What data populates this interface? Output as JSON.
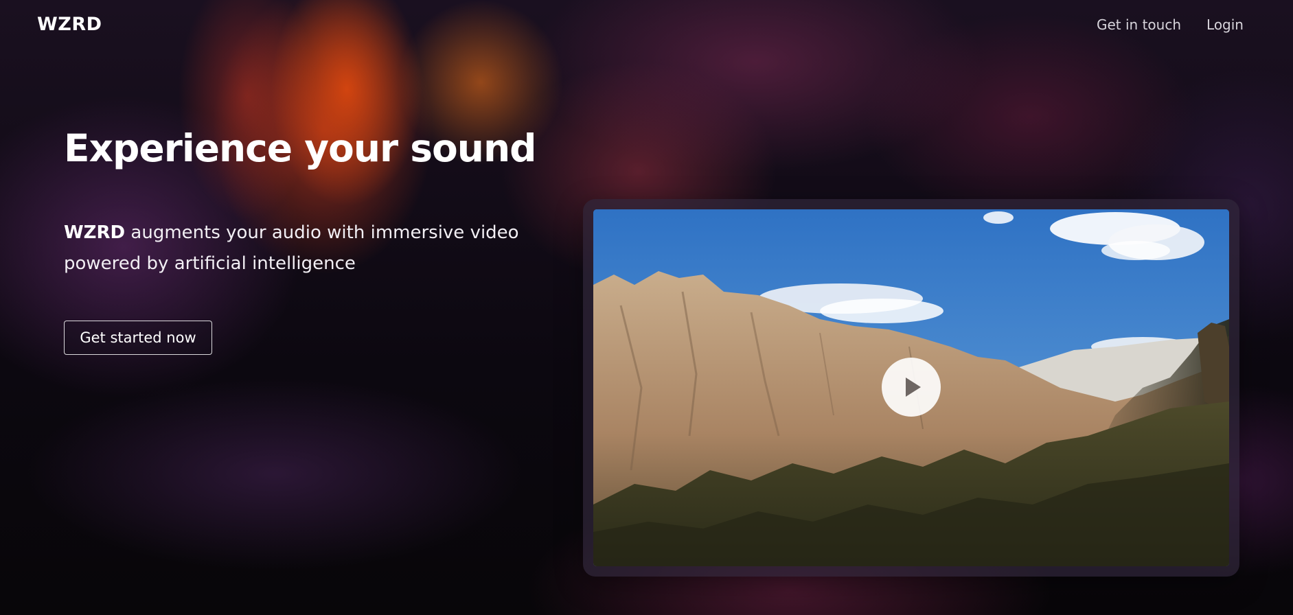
{
  "header": {
    "logo": "WZRD",
    "links": [
      {
        "label": "Get in touch"
      },
      {
        "label": "Login"
      }
    ]
  },
  "hero": {
    "title": "Experience your sound",
    "subtitle_brand": "WZRD",
    "subtitle_text": " augments your audio with immersive video powered by artificial intelligence",
    "cta_label": "Get started now"
  },
  "video": {
    "thumbnail": "mountain-landscape",
    "play_icon": "play-icon"
  },
  "colors": {
    "text": "#ffffff",
    "nav_text": "#d8d5dc",
    "background": "#07060a"
  }
}
